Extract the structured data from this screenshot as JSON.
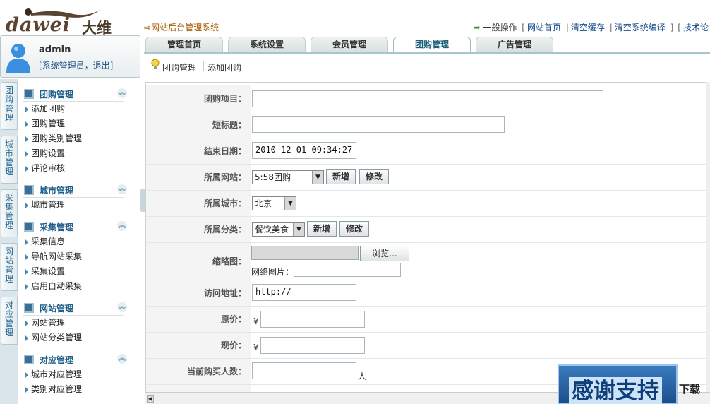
{
  "header": {
    "logo_text": "dawei",
    "logo_cn": "大维",
    "system_title": "网站后台管理系统",
    "quick_links": {
      "label": "一般操作",
      "items": [
        "网站首页",
        "清空缓存",
        "清空系统编译",
        "技术论"
      ]
    }
  },
  "user": {
    "name": "admin",
    "role": "[系统管理员，退出]"
  },
  "tabs": [
    "管理首页",
    "系统设置",
    "会员管理",
    "团购管理",
    "广告管理"
  ],
  "active_tab": "团购管理",
  "subnav": {
    "section": "团购管理",
    "current": "添加团购"
  },
  "vertical_tabs": [
    "团购管理",
    "城市管理",
    "采集管理",
    "网站管理",
    "对应管理"
  ],
  "sidebar": {
    "groups": [
      {
        "title": "团购管理",
        "items": [
          "添加团购",
          "团购管理",
          "团购类别管理",
          "团购设置",
          "评论审核"
        ]
      },
      {
        "title": "城市管理",
        "items": [
          "城市管理"
        ]
      },
      {
        "title": "采集管理",
        "items": [
          "采集信息",
          "导航网站采集",
          "采集设置",
          "启用自动采集"
        ]
      },
      {
        "title": "网站管理",
        "items": [
          "网站管理",
          "网站分类管理"
        ]
      },
      {
        "title": "对应管理",
        "items": [
          "城市对应管理",
          "类别对应管理"
        ]
      }
    ]
  },
  "form": {
    "project_label": "团购项目：",
    "short_title_label": "短标题：",
    "end_date_label": "结束日期：",
    "end_date_value": "2010-12-01 09:34:27",
    "site_label": "所属网站：",
    "site_value": "5:58团购",
    "city_label": "所属城市：",
    "city_value": "北京",
    "category_label": "所属分类：",
    "category_value": "餐饮美食",
    "add_btn": "新增",
    "edit_btn": "修改",
    "thumb_label": "缩略图：",
    "browse_btn": "浏览...",
    "net_image_label": "网络图片：",
    "url_label": "访问地址：",
    "url_value": "http://",
    "orig_price_label": "原价：",
    "cur_price_label": "现价：",
    "currency": "¥",
    "buyers_label": "当前购买人数：",
    "buyers_unit": "人"
  },
  "overlay": {
    "banner_text": "感谢支持",
    "download_text": "下载"
  }
}
